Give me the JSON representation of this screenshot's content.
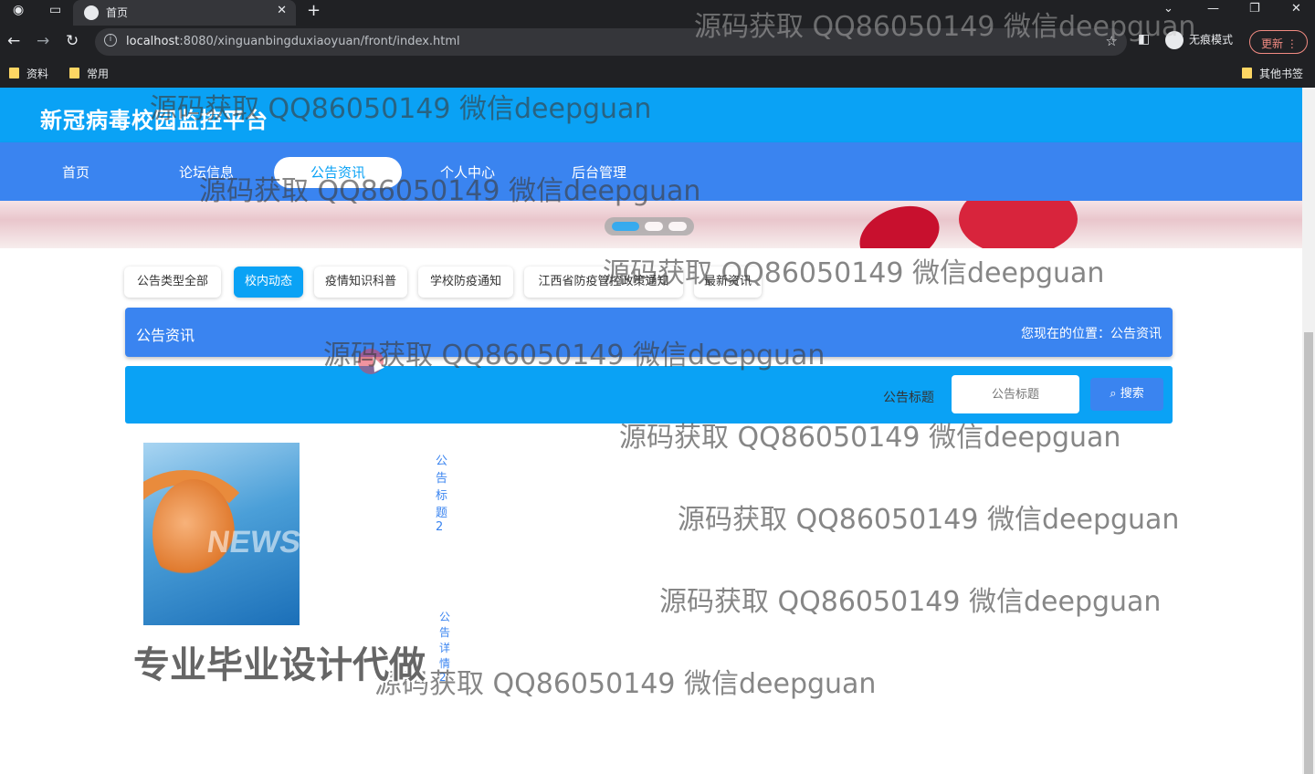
{
  "browser": {
    "tab_title": "首页",
    "url_host": "localhost",
    "url_path": ":8080/xinguanbingduxiaoyuan/front/index.html",
    "incognito_label": "无痕模式",
    "update_label": "更新",
    "bookmarks": [
      "资料",
      "常用"
    ],
    "other_bookmarks": "其他书签"
  },
  "site": {
    "title": "新冠病毒校园监控平台",
    "nav": [
      "首页",
      "论坛信息",
      "公告资讯",
      "个人中心",
      "后台管理"
    ],
    "active_nav": "公告资讯"
  },
  "filters": {
    "items": [
      "公告类型全部",
      "校内动态",
      "疫情知识科普",
      "学校防疫通知",
      "江西省防疫管控政策通知",
      "最新资讯"
    ],
    "active": "校内动态"
  },
  "crumb": {
    "section": "公告资讯",
    "location": "您现在的位置：公告资讯"
  },
  "search": {
    "label": "公告标题",
    "placeholder": "公告标题",
    "button": "搜索"
  },
  "news": [
    {
      "title": "公告标题2",
      "detail": "公告详情2",
      "image_text": "NEWS"
    }
  ],
  "watermarks": {
    "text": "源码获取 QQ86050149 微信deepguan",
    "big": "专业毕业设计代做"
  },
  "colors": {
    "header": "#0aa2f5",
    "nav": "#3a84f0",
    "accent": "#0aa2f5"
  }
}
